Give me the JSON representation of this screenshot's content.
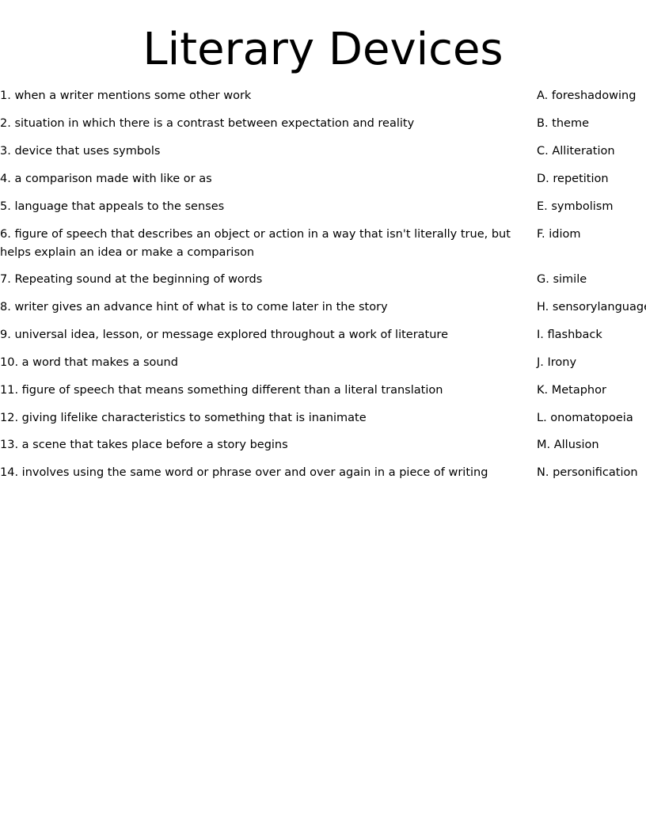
{
  "title": "Literary Devices",
  "clues": [
    "1. when a writer mentions some other work",
    "2. situation in which there is a contrast between expectation and reality",
    "3. device that uses symbols",
    "4. a comparison made with like or as",
    "5. language that appeals to the senses",
    "6. figure of speech that describes an object or action in a way that isn't literally true, but helps explain an idea or make a comparison",
    "7. Repeating sound at the beginning of words",
    "8. writer gives an advance hint of what is to come later in the story",
    "9. universal idea, lesson, or message explored throughout a work of literature",
    "10. a word that makes a sound",
    "11. figure of speech that means something different than a literal translation",
    "12. giving lifelike characteristics to something that is inanimate",
    "13. a scene that takes place before a story begins",
    "14. involves using the same word or phrase over and over again in a piece of writing"
  ],
  "answers": [
    "A. foreshadowing",
    "B. theme",
    "C. Alliteration",
    "D. repetition",
    "E. symbolism",
    "F. idiom",
    "G. simile",
    "H. sensorylanguage",
    "I. flashback",
    "J. Irony",
    "K. Metaphor",
    "L. onomatopoeia",
    "M. Allusion",
    "N. personification"
  ]
}
